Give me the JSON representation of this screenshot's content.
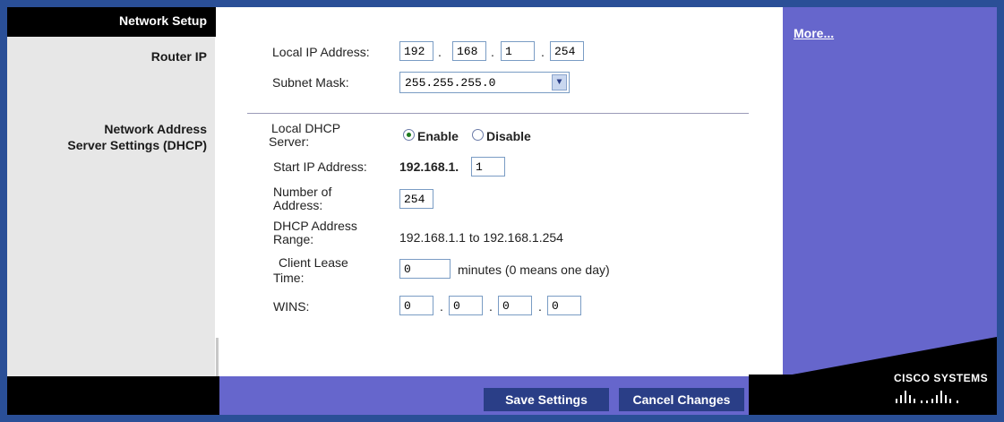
{
  "left": {
    "title": "Network Setup",
    "router_ip_label": "Router IP",
    "dhcp_label_line1": "Network Address",
    "dhcp_label_line2": "Server Settings (DHCP)"
  },
  "right": {
    "more_link": "More...",
    "brand": "CISCO SYSTEMS"
  },
  "router_ip": {
    "local_ip_label": "Local IP Address:",
    "local_ip": [
      "192",
      "168",
      "1",
      "254"
    ],
    "subnet_label": "Subnet Mask:",
    "subnet_value": "255.255.255.0"
  },
  "dhcp": {
    "server_label_line1": "Local DHCP",
    "server_label_line2": "Server:",
    "enable_label": "Enable",
    "disable_label": "Disable",
    "selected": "Enable",
    "start_ip_label": "Start IP Address:",
    "start_ip_prefix": "192.168.1.",
    "start_ip_last": "1",
    "num_label_line1": "Number  of",
    "num_label_line2": "Address:",
    "num_value": "254",
    "range_label_line1": "DHCP  Address",
    "range_label_line2": "Range:",
    "range_value": "192.168.1.1  to  192.168.1.254",
    "lease_label_line1": "Client Lease",
    "lease_label_line2": "Time:",
    "lease_value": "0",
    "lease_suffix": "minutes (0 means one day)",
    "wins_label": "WINS:",
    "wins": [
      "0",
      "0",
      "0",
      "0"
    ]
  },
  "buttons": {
    "save": "Save Settings",
    "cancel": "Cancel Changes"
  },
  "colors": {
    "frame": "#2a4f97",
    "accent_purple": "#6666cc",
    "button": "#2a3e87"
  }
}
